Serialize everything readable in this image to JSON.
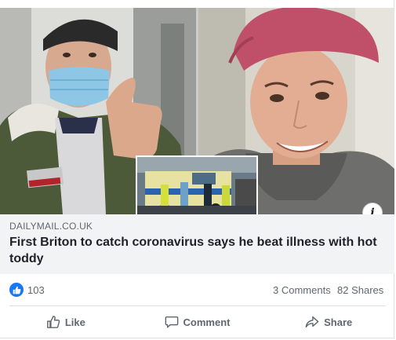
{
  "link": {
    "domain": "DAILYMAIL.CO.UK",
    "headline": "First Briton to catch coronavirus says he beat illness with hot toddy"
  },
  "images": {
    "left": "man-in-face-mask-thumbs-up",
    "right": "smiling-man-red-cap",
    "inset": "ambulance-crew-scene"
  },
  "info_icon_glyph": "i",
  "stats": {
    "likes": "103",
    "comments": "3 Comments",
    "shares": "82 Shares"
  },
  "actions": {
    "like": "Like",
    "comment": "Comment",
    "share": "Share"
  },
  "colors": {
    "accent": "#1877f2",
    "link_bg": "#f2f3f5",
    "text_muted": "#606770"
  }
}
